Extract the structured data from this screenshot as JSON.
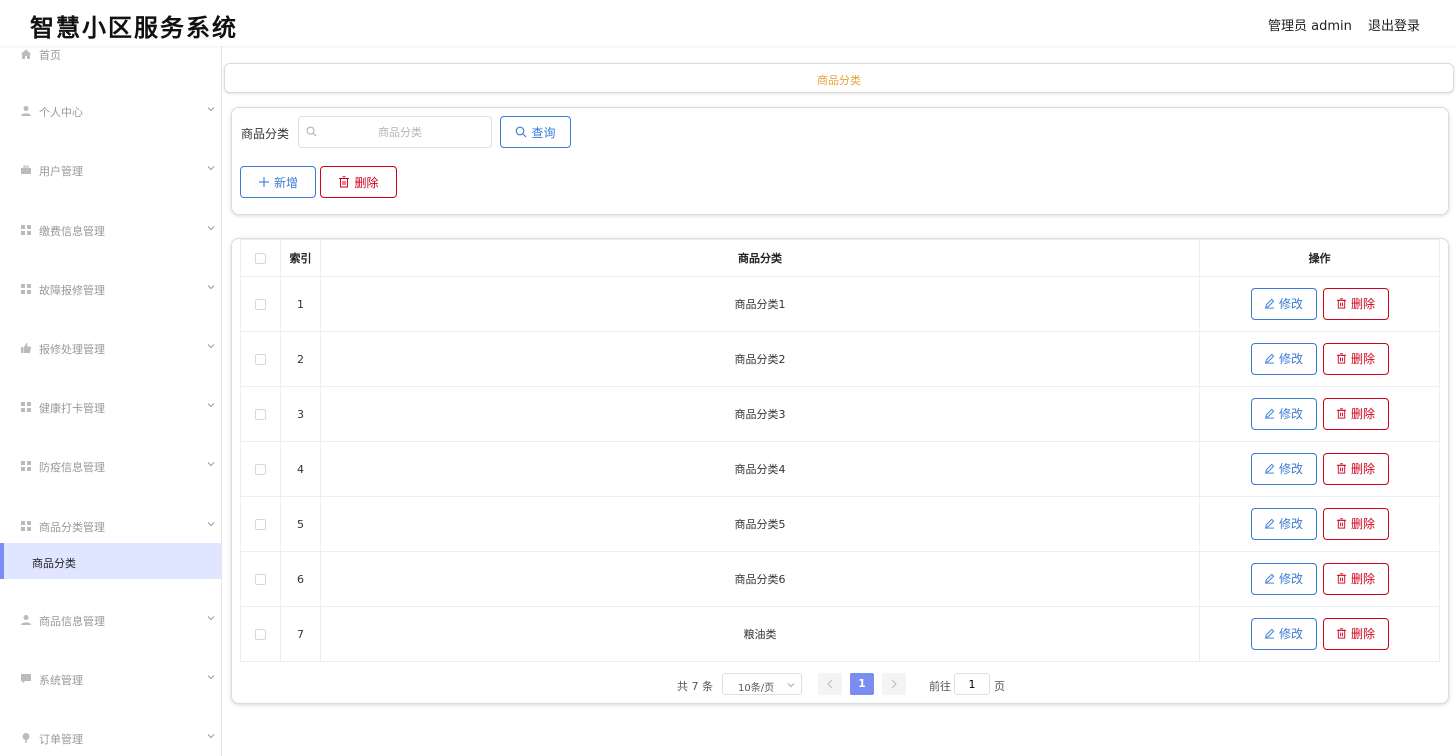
{
  "header": {
    "title": "智慧小区服务系统",
    "user": "管理员 admin",
    "logout": "退出登录"
  },
  "sidebar": {
    "items": [
      {
        "label": "首页",
        "icon": "home-icon"
      },
      {
        "label": "个人中心",
        "icon": "user-icon"
      },
      {
        "label": "用户管理",
        "icon": "briefcase-icon"
      },
      {
        "label": "缴费信息管理",
        "icon": "grid-icon"
      },
      {
        "label": "故障报修管理",
        "icon": "grid-icon"
      },
      {
        "label": "报修处理管理",
        "icon": "thumb-icon"
      },
      {
        "label": "健康打卡管理",
        "icon": "grid-icon"
      },
      {
        "label": "防疫信息管理",
        "icon": "grid-icon"
      },
      {
        "label": "商品分类管理",
        "icon": "grid-icon"
      },
      {
        "label": "商品信息管理",
        "icon": "user-icon"
      },
      {
        "label": "系统管理",
        "icon": "chat-icon"
      },
      {
        "label": "订单管理",
        "icon": "pin-icon"
      }
    ],
    "active_sub": "商品分类"
  },
  "breadcrumb": "商品分类",
  "search": {
    "label": "商品分类",
    "placeholder": "商品分类",
    "query_button": "查询",
    "add_button": "新增",
    "delete_button": "删除"
  },
  "table": {
    "columns": {
      "index": "索引",
      "category": "商品分类",
      "actions": "操作"
    },
    "rows": [
      {
        "index": "1",
        "category": "商品分类1"
      },
      {
        "index": "2",
        "category": "商品分类2"
      },
      {
        "index": "3",
        "category": "商品分类3"
      },
      {
        "index": "4",
        "category": "商品分类4"
      },
      {
        "index": "5",
        "category": "商品分类5"
      },
      {
        "index": "6",
        "category": "商品分类6"
      },
      {
        "index": "7",
        "category": "粮油类"
      }
    ],
    "edit_label": "修改",
    "delete_label": "删除"
  },
  "pagination": {
    "total": "共 7 条",
    "page_size": "10条/页",
    "current_page": "1",
    "goto_label": "前往",
    "goto_value": "1",
    "page_suffix": "页"
  },
  "colors": {
    "primary": "#3a7bd5",
    "danger": "#d0021b",
    "accent": "#7b8df0",
    "breadcrumb": "#e6a23c"
  }
}
